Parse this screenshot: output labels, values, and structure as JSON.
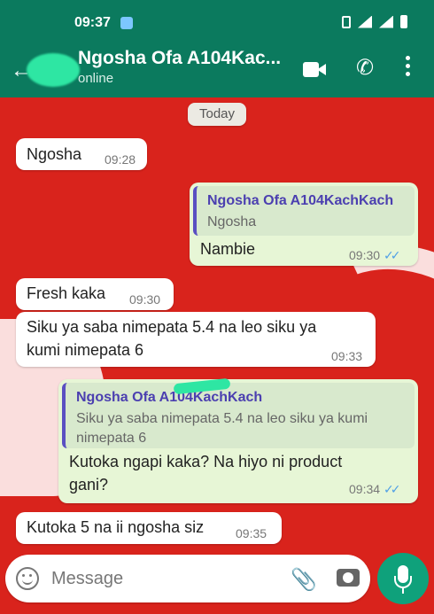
{
  "status_bar": {
    "time": "09:37",
    "network": "4G"
  },
  "header": {
    "chat_name": "Ngosha Ofa A104Kac...",
    "status": "online",
    "icons": [
      "back-arrow-icon",
      "video-call-icon",
      "phone-icon",
      "more-icon"
    ]
  },
  "date_chip": "Today",
  "messages": [
    {
      "direction": "in",
      "text": "Ngosha",
      "time": "09:28"
    },
    {
      "direction": "out",
      "quote_name": "Ngosha Ofa A104KachKach",
      "quote_text": "Ngosha",
      "text": "Nambie",
      "time": "09:30"
    },
    {
      "direction": "in",
      "text": "Fresh kaka",
      "time": "09:30"
    },
    {
      "direction": "in",
      "text": "Siku ya saba nimepata 5.4 na leo siku ya kumi nimepata 6",
      "time": "09:33"
    },
    {
      "direction": "out",
      "quote_name": "Ngosha Ofa A104KachKach",
      "quote_text": "Siku ya saba nimepata 5.4 na leo siku ya kumi nimepata 6",
      "text": "Kutoka ngapi kaka? Na hiyo ni product gani?",
      "time": "09:34"
    },
    {
      "direction": "in",
      "text": "Kutoka 5 na ii ngosha siz",
      "time": "09:35"
    }
  ],
  "composer": {
    "placeholder": "Message"
  },
  "colors": {
    "header": "#0b7a5e",
    "incoming": "#ffffff",
    "outgoing": "#e7f6d6",
    "accent": "#0fa17b",
    "read_ticks": "#4f9fe6"
  }
}
